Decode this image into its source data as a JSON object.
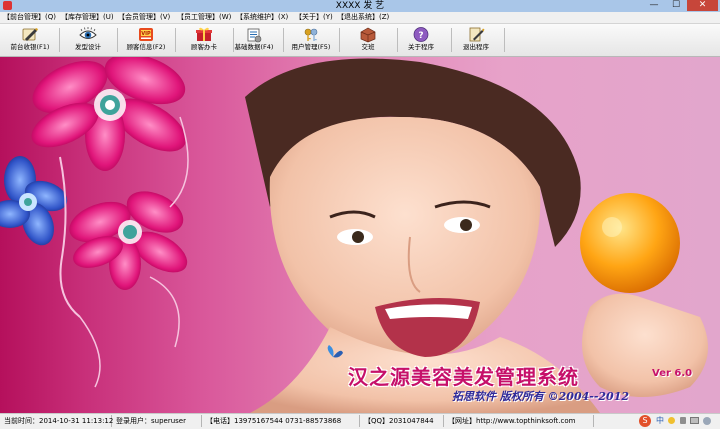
{
  "window": {
    "title": "XXXX 发 艺",
    "min_glyph": "—",
    "max_glyph": "☐",
    "close_glyph": "✕"
  },
  "menu": [
    {
      "label": "【前台管理】(Q)",
      "name": "menu-front-desk"
    },
    {
      "label": "【库存管理】(U)",
      "name": "menu-inventory"
    },
    {
      "label": "【会员管理】(V)",
      "name": "menu-member"
    },
    {
      "label": "【员工管理】(W)",
      "name": "menu-staff"
    },
    {
      "label": "【系统维护】(X)",
      "name": "menu-system"
    },
    {
      "label": "【关于】(Y)",
      "name": "menu-about"
    },
    {
      "label": "【退出系统】(Z)",
      "name": "menu-exit"
    }
  ],
  "toolbar": [
    {
      "label": "前台收银(F1)",
      "icon": "cashier-pen-icon"
    },
    {
      "label": "发型设计",
      "icon": "eye-icon"
    },
    {
      "label": "顾客信息(F2)",
      "icon": "customer-card-icon"
    },
    {
      "label": "顾客办卡",
      "icon": "gift-card-icon"
    },
    {
      "label": "基础数据(F4)",
      "icon": "data-tools-icon"
    },
    {
      "label": "用户管理(F5)",
      "icon": "user-keys-icon"
    },
    {
      "label": "交班",
      "icon": "handover-icon"
    },
    {
      "label": "关于程序",
      "icon": "help-icon"
    },
    {
      "label": "退出程序",
      "icon": "exit-icon"
    }
  ],
  "banner": {
    "title": "汉之源美容美发管理系统",
    "version": "Ver 6.0",
    "copyright": "拓思软件 版权所有 ©2004--2012"
  },
  "status": {
    "time": "当前时间：2014-10-31 11:13:12",
    "user": "登录用户：superuser",
    "phone": "【电话】13975167544  0731-88573868",
    "qq": "【QQ】2031047844",
    "website": "【网址】http://www.topthinksoft.com",
    "tray_ime": "中",
    "tray_s": "S"
  },
  "colors": {
    "accent": "#c6106a",
    "subtitle": "#2f2a9a",
    "close": "#c7463a"
  }
}
